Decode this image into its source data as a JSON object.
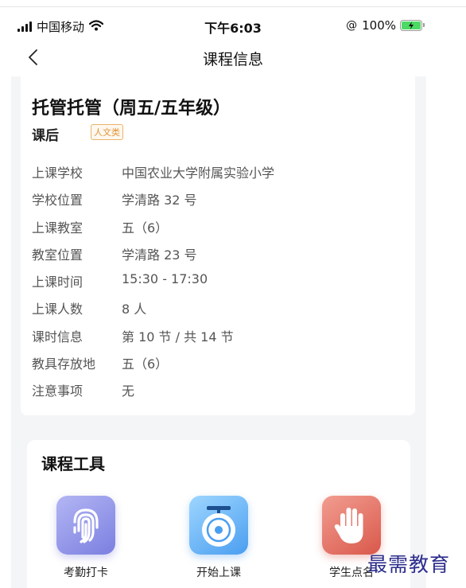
{
  "status_bar": {
    "carrier": "中国移动",
    "time": "下午6:03",
    "battery_text": "100%",
    "battery_color": "#4cd964"
  },
  "nav": {
    "title": "课程信息",
    "back_icon": "chevron-left-icon"
  },
  "course": {
    "title": "托管托管（周五/五年级）",
    "type": "课后",
    "tag": "人文类",
    "tag_color": "#e0953a",
    "details": [
      {
        "label": "上课学校",
        "value": "中国农业大学附属实验小学"
      },
      {
        "label": "学校位置",
        "value": "学清路 32 号"
      },
      {
        "label": "上课教室",
        "value": "五（6）"
      },
      {
        "label": "教室位置",
        "value": "学清路 23 号"
      },
      {
        "label": "上课时间",
        "value": "15:30 - 17:30"
      },
      {
        "label": "上课人数",
        "value": "8 人"
      },
      {
        "label": "课时信息",
        "value": "第 10 节 / 共 14 节"
      },
      {
        "label": "教具存放地",
        "value": "五（6）"
      },
      {
        "label": "注意事项",
        "value": "无"
      }
    ]
  },
  "tools": {
    "title": "课程工具",
    "items": [
      {
        "label": "考勤打卡",
        "icon": "fingerprint-icon",
        "color": "#7b7fe0"
      },
      {
        "label": "开始上课",
        "icon": "bell-icon",
        "color": "#4a9ef0"
      },
      {
        "label": "学生点名",
        "icon": "raised-hand-icon",
        "color": "#d9584b"
      }
    ]
  },
  "watermark": "最需教育"
}
